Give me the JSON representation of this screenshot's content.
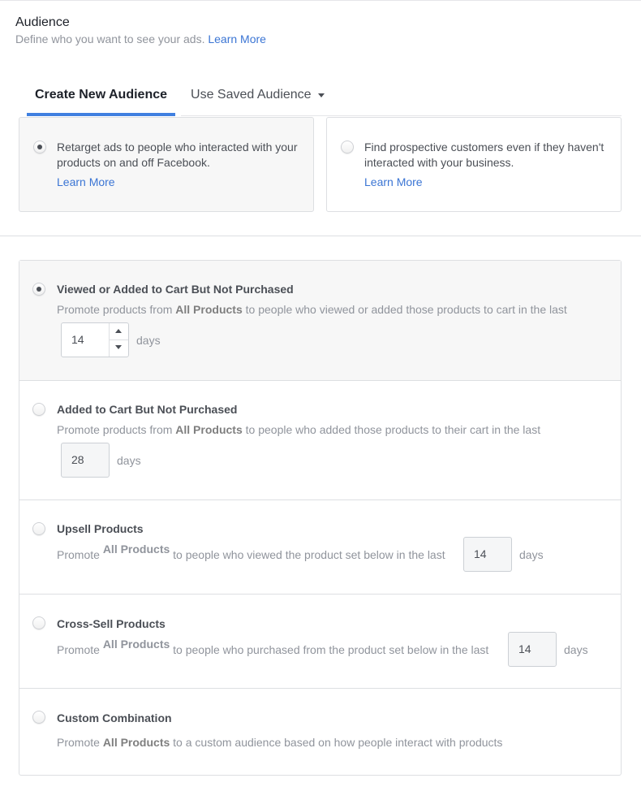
{
  "header": {
    "title": "Audience",
    "subtitle": "Define who you want to see your ads.",
    "learn_more": "Learn More"
  },
  "tabs": [
    {
      "label": "Create New Audience",
      "active": true
    },
    {
      "label": "Use Saved Audience",
      "active": false,
      "icon": "caret-down-icon"
    }
  ],
  "audience_types": [
    {
      "text": "Retarget ads to people who interacted with your products on and off Facebook.",
      "link": "Learn More",
      "selected": true
    },
    {
      "text": "Find prospective customers even if they haven't interacted with your business.",
      "link": "Learn More",
      "selected": false
    }
  ],
  "options": [
    {
      "title": "Viewed or Added to Cart But Not Purchased",
      "desc_prefix": "Promote products from",
      "product_set": "All Products",
      "desc_suffix": "to people who viewed or added those products to cart in the last",
      "days_value": "14",
      "days_label": "days",
      "selected": true
    },
    {
      "title": "Added to Cart But Not Purchased",
      "desc_prefix": "Promote products from",
      "product_set": "All Products",
      "desc_suffix": "to people who added those products to their cart in the last",
      "days_value": "28",
      "days_label": "days",
      "selected": false
    },
    {
      "title": "Upsell Products",
      "desc_prefix": "Promote",
      "product_set": "All Products",
      "desc_suffix": "to people who viewed the product set below in the last",
      "days_value": "14",
      "days_label": "days",
      "selected": false
    },
    {
      "title": "Cross-Sell Products",
      "desc_prefix": "Promote",
      "product_set": "All Products",
      "desc_suffix": "to people who purchased from the product set below in the last",
      "days_value": "14",
      "days_label": "days",
      "selected": false
    },
    {
      "title": "Custom Combination",
      "desc_prefix": "Promote",
      "product_set": "All Products",
      "desc_suffix": "to a custom audience based on how people interact with products",
      "selected": false
    }
  ],
  "colors": {
    "accent": "#4080e0",
    "link": "#3b75d4",
    "selected_bg": "#f7f7f7",
    "border": "#dddfe2"
  }
}
